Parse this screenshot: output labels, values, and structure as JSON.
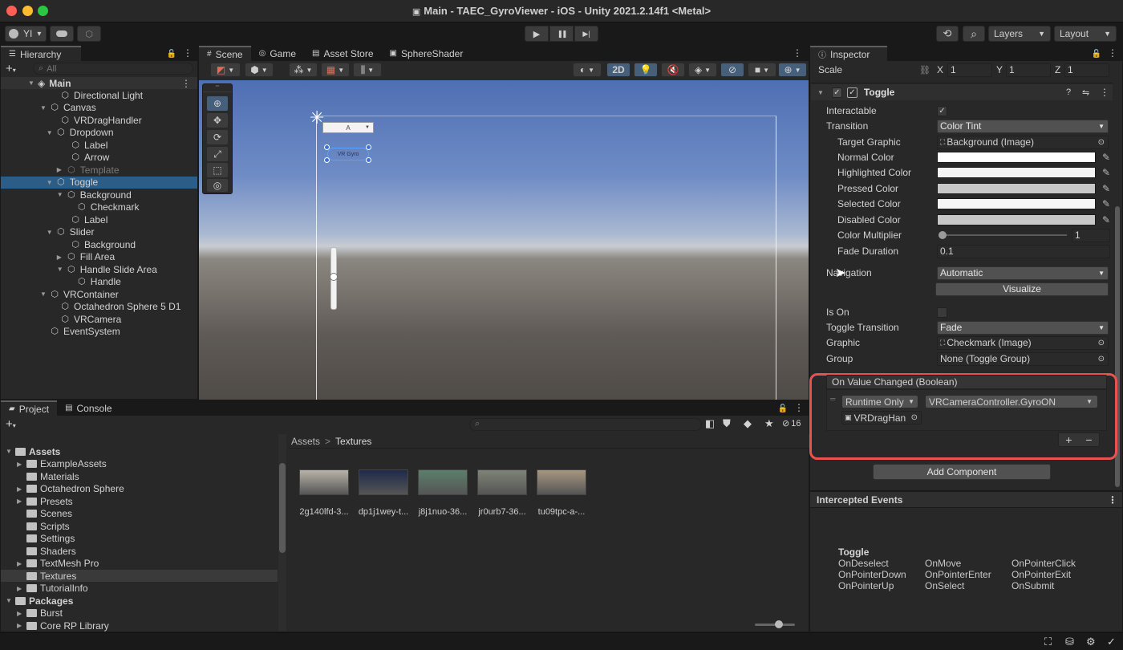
{
  "window": {
    "title": "Main - TAEC_GyroViewer - iOS - Unity 2021.2.14f1 <Metal>",
    "traffic": {
      "close": "#ff5f57",
      "minimize": "#febc2e",
      "maximize": "#28c840"
    }
  },
  "toolbar": {
    "account_label": "YI",
    "account_arrow": "▾",
    "play_icon": "▶",
    "pause_icon": "❚❚",
    "step_icon": "▶|",
    "history_icon": "⟲",
    "search_icon": "⌕",
    "layers_label": "Layers",
    "layout_label": "Layout"
  },
  "hierarchy": {
    "tab_label": "Hierarchy",
    "search_placeholder": "All",
    "scene_name": "Main",
    "items": [
      {
        "label": "Directional Light",
        "depth": 2,
        "arrow": "",
        "dim": false,
        "selected": false
      },
      {
        "label": "Canvas",
        "depth": 1,
        "arrow": "▼",
        "dim": false,
        "selected": false
      },
      {
        "label": "VRDragHandler",
        "depth": 2,
        "arrow": "",
        "dim": false,
        "selected": false
      },
      {
        "label": "Dropdown",
        "depth": 1.6,
        "arrow": "▼",
        "dim": false,
        "selected": false
      },
      {
        "label": "Label",
        "depth": 3,
        "arrow": "",
        "dim": false,
        "selected": false
      },
      {
        "label": "Arrow",
        "depth": 3,
        "arrow": "",
        "dim": false,
        "selected": false
      },
      {
        "label": "Template",
        "depth": 2.6,
        "arrow": "▶",
        "dim": true,
        "selected": false
      },
      {
        "label": "Toggle",
        "depth": 1.6,
        "arrow": "▼",
        "dim": false,
        "selected": true
      },
      {
        "label": "Background",
        "depth": 2.6,
        "arrow": "▼",
        "dim": false,
        "selected": false
      },
      {
        "label": "Checkmark",
        "depth": 3.6,
        "arrow": "",
        "dim": false,
        "selected": false
      },
      {
        "label": "Label",
        "depth": 3,
        "arrow": "",
        "dim": false,
        "selected": false
      },
      {
        "label": "Slider",
        "depth": 1.6,
        "arrow": "▼",
        "dim": false,
        "selected": false
      },
      {
        "label": "Background",
        "depth": 3,
        "arrow": "",
        "dim": false,
        "selected": false
      },
      {
        "label": "Fill Area",
        "depth": 2.6,
        "arrow": "▶",
        "dim": false,
        "selected": false
      },
      {
        "label": "Handle Slide Area",
        "depth": 2.6,
        "arrow": "▼",
        "dim": false,
        "selected": false
      },
      {
        "label": "Handle",
        "depth": 3.6,
        "arrow": "",
        "dim": false,
        "selected": false
      },
      {
        "label": "VRContainer",
        "depth": 1,
        "arrow": "▼",
        "dim": false,
        "selected": false
      },
      {
        "label": "Octahedron Sphere 5 D1",
        "depth": 2,
        "arrow": "",
        "dim": false,
        "selected": false
      },
      {
        "label": "VRCamera",
        "depth": 2,
        "arrow": "",
        "dim": false,
        "selected": false
      },
      {
        "label": "EventSystem",
        "depth": 1,
        "arrow": "",
        "dim": false,
        "selected": false
      }
    ]
  },
  "scene_tabs": {
    "scene": "Scene",
    "game": "Game",
    "asset_store": "Asset Store",
    "sphere_shader": "SphereShader",
    "btn_2d": "2D"
  },
  "scene_view": {
    "dropdown_text": "A",
    "toggle_text": "VR Gyro",
    "slider_value_fraction": 0.45
  },
  "inspector": {
    "tab_label": "Inspector",
    "scale_label": "Scale",
    "scale_x_label": "X",
    "scale_x": "1",
    "scale_y_label": "Y",
    "scale_y": "1",
    "scale_z_label": "Z",
    "scale_z": "1",
    "component_title": "Toggle",
    "interactable_label": "Interactable",
    "interactable_checked": true,
    "transition_label": "Transition",
    "transition_value": "Color Tint",
    "target_graphic_label": "Target Graphic",
    "target_graphic_value": "Background (Image)",
    "normal_color_label": "Normal Color",
    "normal_color": "#ffffff",
    "highlighted_color_label": "Highlighted Color",
    "highlighted_color": "#f5f5f5",
    "pressed_color_label": "Pressed Color",
    "pressed_color": "#c8c8c8",
    "selected_color_label": "Selected Color",
    "selected_color": "#f5f5f5",
    "disabled_color_label": "Disabled Color",
    "disabled_color": "#c8c8c8",
    "color_multiplier_label": "Color Multiplier",
    "color_multiplier_value": "1",
    "color_multiplier_fraction": 0.0,
    "fade_duration_label": "Fade Duration",
    "fade_duration_value": "0.1",
    "navigation_label": "Navigation",
    "navigation_value": "Automatic",
    "visualize_label": "Visualize",
    "is_on_label": "Is On",
    "is_on_checked": false,
    "toggle_transition_label": "Toggle Transition",
    "toggle_transition_value": "Fade",
    "graphic_label": "Graphic",
    "graphic_value": "Checkmark (Image)",
    "group_label": "Group",
    "group_value": "None (Toggle Group)",
    "event_title": "On Value Changed (Boolean)",
    "runtime_value": "Runtime Only",
    "function_value": "VRCameraController.GyroON",
    "object_value": "VRDragHan",
    "plus_label": "+",
    "minus_label": "−",
    "add_component_label": "Add Component",
    "highlight_color": "#e8524f"
  },
  "intercepted": {
    "title": "Intercepted Events",
    "group_title": "Toggle",
    "events": [
      [
        "OnDeselect",
        "OnMove",
        "OnPointerClick"
      ],
      [
        "OnPointerDown",
        "OnPointerEnter",
        "OnPointerExit"
      ],
      [
        "OnPointerUp",
        "OnSelect",
        "OnSubmit"
      ]
    ]
  },
  "project": {
    "tab_project": "Project",
    "tab_console": "Console",
    "hidden_count": "16",
    "breadcrumb_root": "Assets",
    "breadcrumb_sep": ">",
    "breadcrumb_current": "Textures",
    "tree": [
      {
        "label": "Assets",
        "depth": 0,
        "arrow": "▼",
        "bold": true,
        "selected": false
      },
      {
        "label": "ExampleAssets",
        "depth": 1,
        "arrow": "▶",
        "bold": false,
        "selected": false
      },
      {
        "label": "Materials",
        "depth": 1,
        "arrow": "",
        "bold": false,
        "selected": false
      },
      {
        "label": "Octahedron Sphere",
        "depth": 1,
        "arrow": "▶",
        "bold": false,
        "selected": false
      },
      {
        "label": "Presets",
        "depth": 1,
        "arrow": "▶",
        "bold": false,
        "selected": false
      },
      {
        "label": "Scenes",
        "depth": 1,
        "arrow": "",
        "bold": false,
        "selected": false
      },
      {
        "label": "Scripts",
        "depth": 1,
        "arrow": "",
        "bold": false,
        "selected": false
      },
      {
        "label": "Settings",
        "depth": 1,
        "arrow": "",
        "bold": false,
        "selected": false
      },
      {
        "label": "Shaders",
        "depth": 1,
        "arrow": "",
        "bold": false,
        "selected": false
      },
      {
        "label": "TextMesh Pro",
        "depth": 1,
        "arrow": "▶",
        "bold": false,
        "selected": false
      },
      {
        "label": "Textures",
        "depth": 1,
        "arrow": "",
        "bold": false,
        "selected": true
      },
      {
        "label": "TutorialInfo",
        "depth": 1,
        "arrow": "▶",
        "bold": false,
        "selected": false
      },
      {
        "label": "Packages",
        "depth": 0,
        "arrow": "▼",
        "bold": true,
        "selected": false
      },
      {
        "label": "Burst",
        "depth": 1,
        "arrow": "▶",
        "bold": false,
        "selected": false
      },
      {
        "label": "Core RP Library",
        "depth": 1,
        "arrow": "▶",
        "bold": false,
        "selected": false
      }
    ],
    "assets": [
      {
        "label": "2g140lfd-3...",
        "color": "#b9b3a8"
      },
      {
        "label": "dp1j1wey-t...",
        "color": "#1e2a4a"
      },
      {
        "label": "j8j1nuo-36...",
        "color": "#5b7f6c"
      },
      {
        "label": "jr0urb7-36...",
        "color": "#7d8477"
      },
      {
        "label": "tu09tpc-a-...",
        "color": "#a89680"
      }
    ]
  }
}
